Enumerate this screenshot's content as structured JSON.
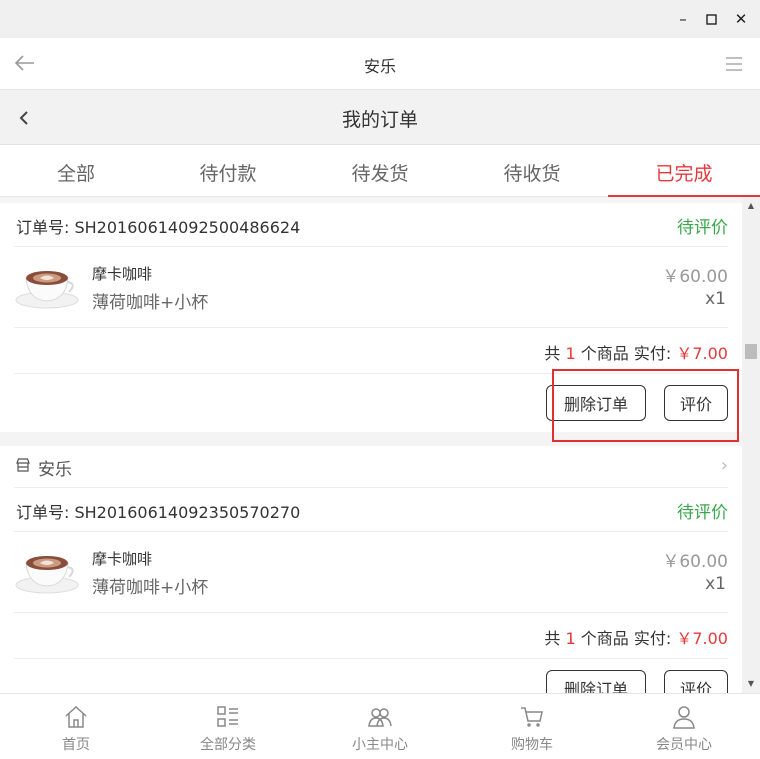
{
  "window": {
    "minimize": "–",
    "maximize": "□",
    "close": "✕"
  },
  "appbar": {
    "title": "安乐",
    "back_icon": "arrow-left-icon",
    "menu_icon": "hamburger-icon"
  },
  "page": {
    "title": "我的订单",
    "back_icon": "chevron-left-icon"
  },
  "tabs": [
    {
      "label": "全部",
      "active": false
    },
    {
      "label": "待付款",
      "active": false
    },
    {
      "label": "待发货",
      "active": false
    },
    {
      "label": "待收货",
      "active": false
    },
    {
      "label": "已完成",
      "active": true
    }
  ],
  "orders": [
    {
      "order_no": "订单号: SH20160614092500486624",
      "status": "待评价",
      "item": {
        "name": "摩卡咖啡",
        "spec": "薄荷咖啡+小杯",
        "price": "￥60.00",
        "qty": "x1"
      },
      "summary": {
        "prefix": "共",
        "count": "1",
        "mid": "个商品 实付:",
        "total": "￥7.00"
      },
      "actions": {
        "delete": "删除订单",
        "rate": "评价"
      }
    },
    {
      "shop": "安乐",
      "order_no": "订单号: SH20160614092350570270",
      "status": "待评价",
      "item": {
        "name": "摩卡咖啡",
        "spec": "薄荷咖啡+小杯",
        "price": "￥60.00",
        "qty": "x1"
      },
      "summary": {
        "prefix": "共",
        "count": "1",
        "mid": "个商品 实付:",
        "total": "￥7.00"
      },
      "actions": {
        "delete": "删除订单",
        "rate": "评价"
      }
    }
  ],
  "bottom_nav": [
    {
      "label": "首页",
      "icon": "home-icon"
    },
    {
      "label": "全部分类",
      "icon": "category-icon"
    },
    {
      "label": "小主中心",
      "icon": "group-icon"
    },
    {
      "label": "购物车",
      "icon": "cart-icon"
    },
    {
      "label": "会员中心",
      "icon": "user-icon"
    }
  ],
  "colors": {
    "accent": "#e4393c",
    "status_green": "#3aa74b"
  }
}
